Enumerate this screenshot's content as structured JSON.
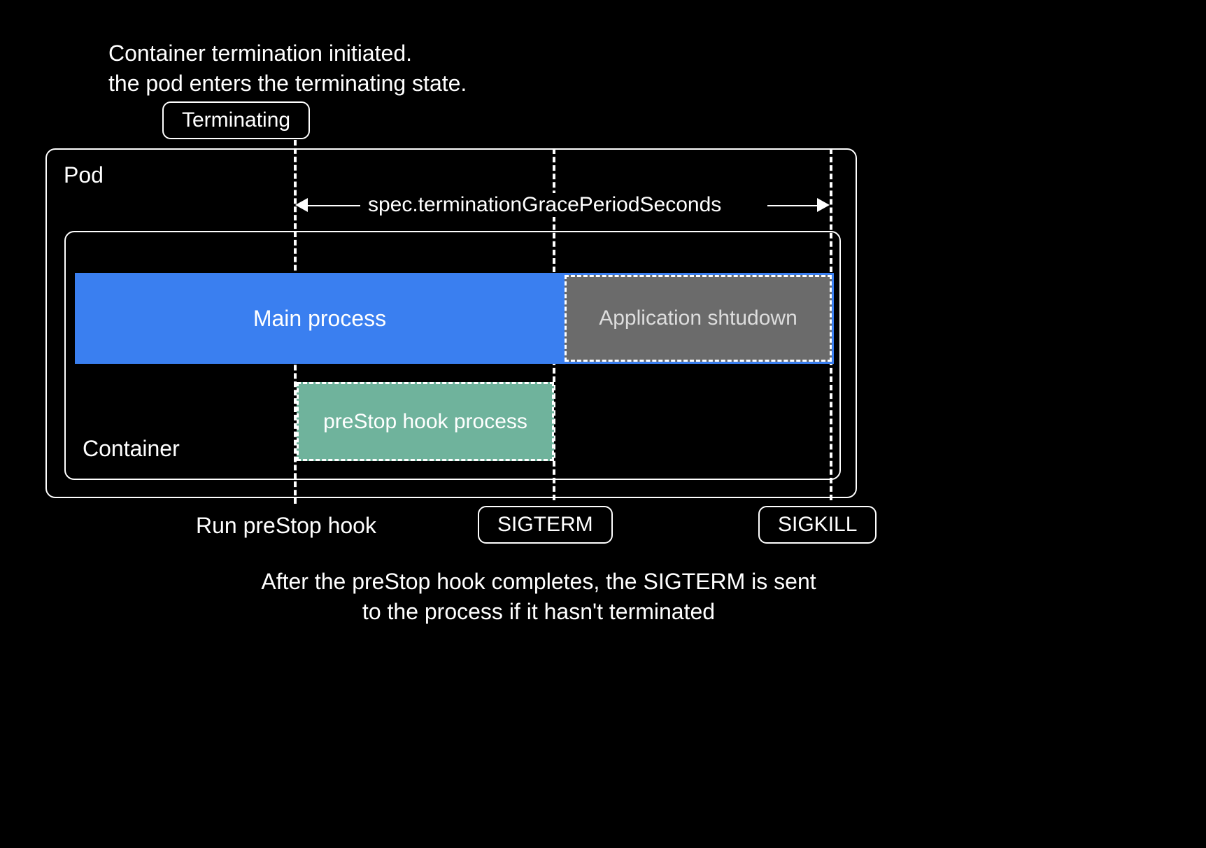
{
  "topCaption": {
    "line1": "Container termination initiated.",
    "line2": "the pod enters the terminating state."
  },
  "terminatingLabel": "Terminating",
  "podLabel": "Pod",
  "containerLabel": "Container",
  "gracePeriodLabel": "spec.terminationGracePeriodSeconds",
  "mainProcessLabel": "Main process",
  "appShutdownLabel": "Application shtudown",
  "prestopLabel": "preStop hook process",
  "runPrestopLabel": "Run preStop hook",
  "sigtermLabel": "SIGTERM",
  "sigkillLabel": "SIGKILL",
  "bottomCaption": "After the preStop hook completes, the SIGTERM is sent to the process if it hasn't terminated",
  "timeline": {
    "events": [
      "Terminating",
      "SIGTERM",
      "SIGKILL"
    ],
    "phases": [
      {
        "name": "preStop hook process",
        "start": "Terminating",
        "end": "SIGTERM"
      },
      {
        "name": "Application shutdown",
        "start": "SIGTERM",
        "end": "SIGKILL"
      },
      {
        "name": "Main process",
        "start": "before",
        "end": "SIGKILL"
      }
    ],
    "gracePeriodSpan": {
      "start": "Terminating",
      "end": "SIGKILL"
    }
  }
}
